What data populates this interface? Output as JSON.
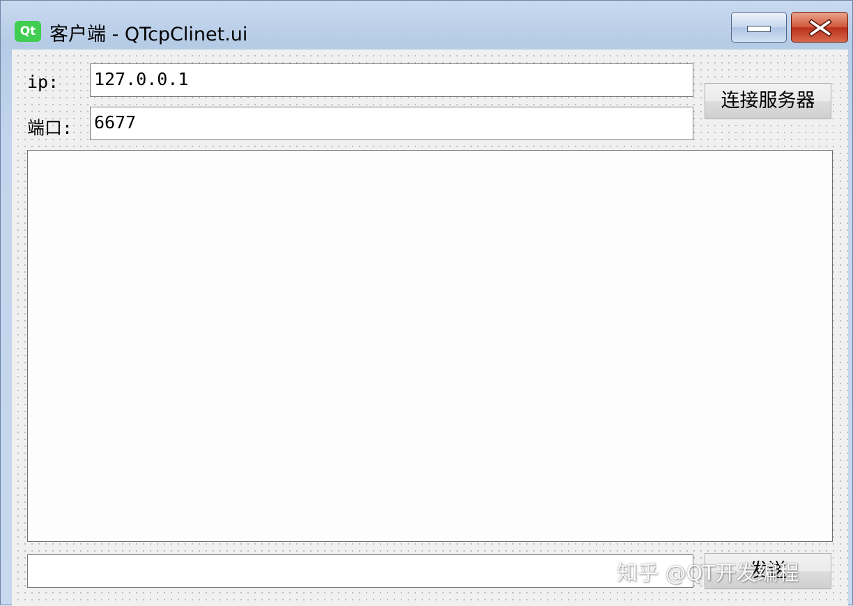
{
  "window": {
    "logo_text": "Qt",
    "title": "客户端 - QTcpClinet.ui"
  },
  "form": {
    "ip_label": "ip:",
    "ip_value": "127.0.0.1",
    "port_label": "端口:",
    "port_value": "6677",
    "connect_button": "连接服务器",
    "message_input_value": "",
    "send_button": "发送"
  },
  "watermark": "知乎 @QT开发编程"
}
